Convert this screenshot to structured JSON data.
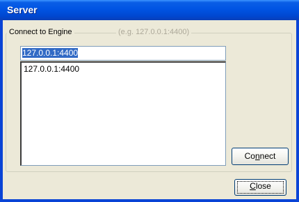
{
  "window": {
    "title": "Server"
  },
  "group": {
    "legend": "Connect to Engine",
    "hint": "(e.g. 127.0.0.1:4400)"
  },
  "engine_address": {
    "value": "127.0.0.1:4400"
  },
  "history_list": {
    "items": [
      "127.0.0.1:4400"
    ]
  },
  "buttons": {
    "connect_pre": "Co",
    "connect_accel": "n",
    "connect_post": "nect",
    "close_pre": "",
    "close_accel": "C",
    "close_post": "lose"
  },
  "colors": {
    "titlebar": "#0054e3",
    "selection": "#316ac5",
    "window_bg": "#ece9d8"
  }
}
